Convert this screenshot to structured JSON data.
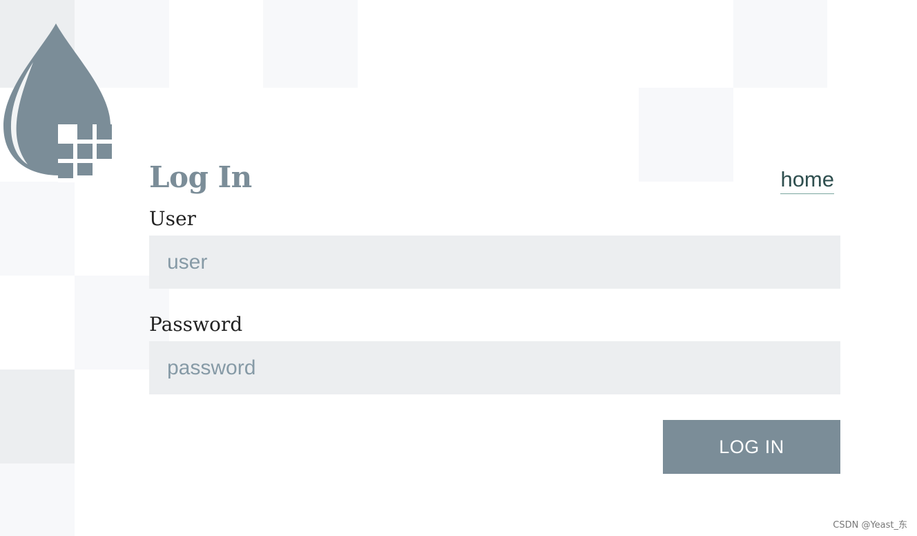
{
  "header": {
    "title": "Log In",
    "home_link": "home"
  },
  "form": {
    "user": {
      "label": "User",
      "placeholder": "user",
      "value": ""
    },
    "password": {
      "label": "Password",
      "placeholder": "password",
      "value": ""
    },
    "submit_label": "LOG IN"
  },
  "watermark": "CSDN @Yeast_东",
  "colors": {
    "accent": "#7b8d98",
    "input_bg": "#eceef0",
    "link": "#2f4f4f"
  },
  "icons": {
    "logo": "nifi-drop-icon"
  }
}
